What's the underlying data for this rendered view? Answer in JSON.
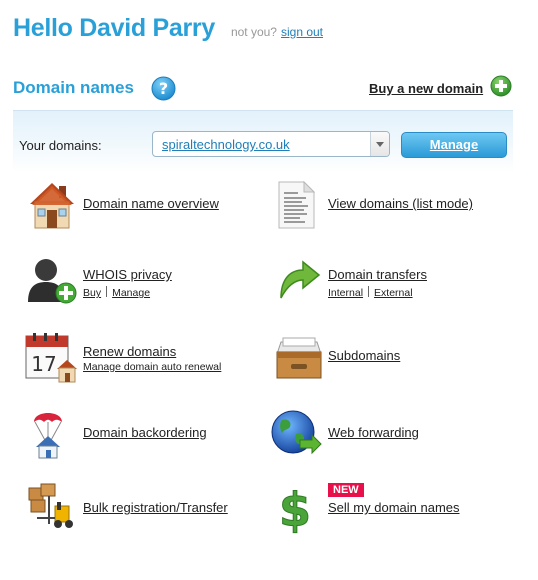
{
  "greeting": {
    "hello": "Hello David Parry",
    "not_you": "not you?",
    "sign_out": "sign out"
  },
  "section": {
    "title": "Domain names",
    "buy_new": "Buy a new domain"
  },
  "domain_bar": {
    "label": "Your domains:",
    "selected_domain": "spiraltechnology.co.uk",
    "manage": "Manage"
  },
  "items": {
    "overview": {
      "title": "Domain name overview"
    },
    "list_mode": {
      "title": "View domains (list mode)"
    },
    "whois": {
      "title": "WHOIS privacy",
      "sub1": "Buy",
      "sub2": "Manage"
    },
    "transfers": {
      "title": "Domain transfers",
      "sub1": "Internal",
      "sub2": "External"
    },
    "renew": {
      "title": "Renew domains",
      "sub1": "Manage domain auto renewal"
    },
    "subdomains": {
      "title": "Subdomains"
    },
    "backorder": {
      "title": "Domain backordering"
    },
    "forwarding": {
      "title": "Web forwarding"
    },
    "bulk": {
      "title": "Bulk registration/Transfer"
    },
    "sell": {
      "title": "Sell my domain names",
      "badge": "NEW"
    }
  },
  "calendar_day": "17",
  "colors": {
    "accent": "#2aa0d8",
    "new_badge": "#e8104a",
    "add_green": "#3aa635"
  }
}
